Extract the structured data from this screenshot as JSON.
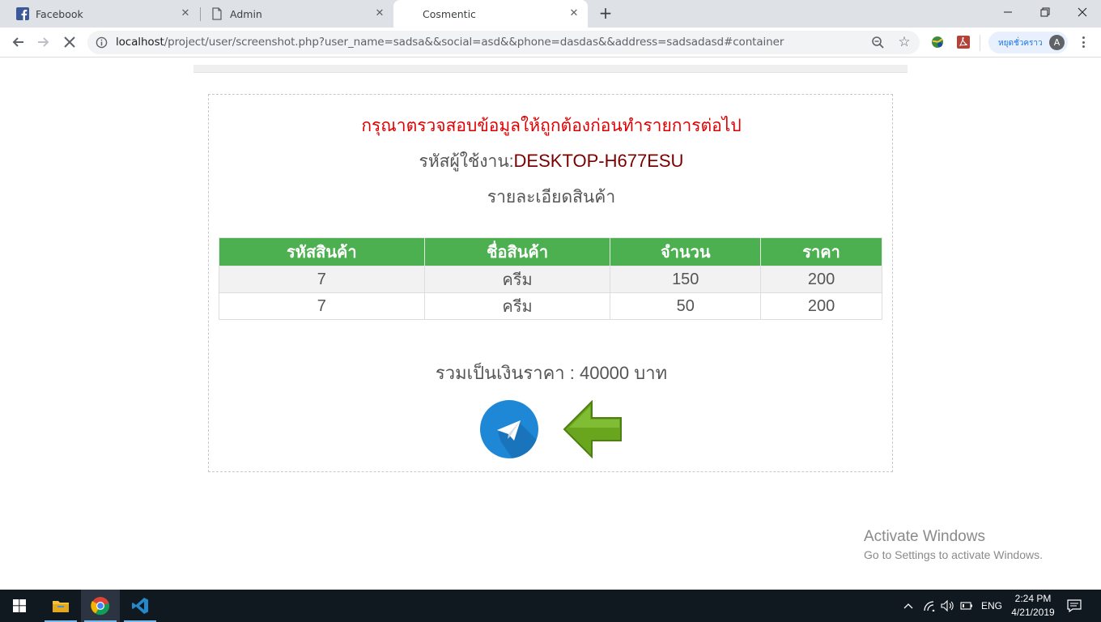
{
  "browser": {
    "tabs": [
      {
        "title": "Facebook",
        "icon": "facebook-icon",
        "active": false
      },
      {
        "title": "Admin",
        "icon": "document-icon",
        "active": false
      },
      {
        "title": "Cosmentic",
        "icon": "",
        "active": true
      }
    ],
    "url_host": "localhost",
    "url_rest": "/project/user/screenshot.php?user_name=sadsa&&social=asd&&phone=dasdas&&address=sadsadasd#container",
    "profile_label": "หยุดชั่วคราว",
    "profile_initial": "A"
  },
  "page": {
    "warning": "กรุณาตรวจสอบข้อมูลให้ถูกต้องก่อนทำรายการต่อไป",
    "user_label": "รหัสผู้ใช้งาน:",
    "user_id": "DESKTOP-H677ESU",
    "subheading": "รายละเอียดสินค้า",
    "table": {
      "headers": [
        "รหัสสินค้า",
        "ชื่อสินค้า",
        "จำนวน",
        "ราคา"
      ],
      "rows": [
        [
          "7",
          "ครีม",
          "150",
          "200"
        ],
        [
          "7",
          "ครีม",
          "50",
          "200"
        ]
      ]
    },
    "total": "รวมเป็นเงินราคา : 40000 บาท",
    "send_button": "send-icon",
    "back_button": "back-arrow-icon"
  },
  "watermark": {
    "line1": "Activate Windows",
    "line2": "Go to Settings to activate Windows."
  },
  "taskbar": {
    "language": "ENG",
    "time": "2:24 PM",
    "date": "4/21/2019"
  },
  "colors": {
    "table_header": "#4caf50",
    "warning": "#e00000",
    "user_id": "#7a0000",
    "send_button": "#1e88d6",
    "back_arrow": "#6aa51e"
  }
}
